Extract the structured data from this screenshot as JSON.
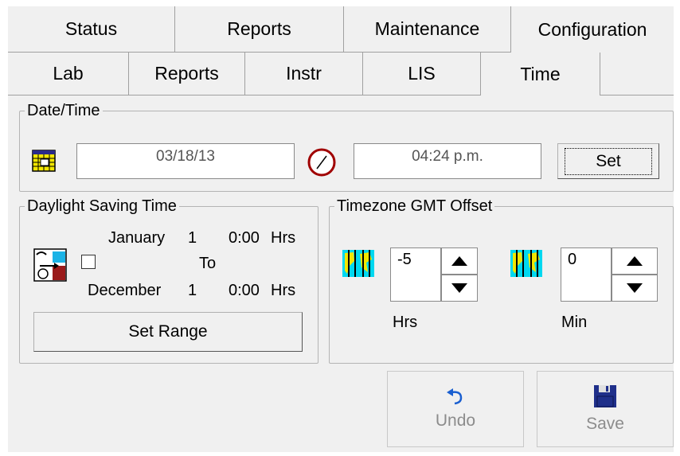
{
  "tabs_top": [
    {
      "label": "Status"
    },
    {
      "label": "Reports"
    },
    {
      "label": "Maintenance"
    },
    {
      "label": "Configuration",
      "active": true
    }
  ],
  "tabs_sub": [
    {
      "label": "Lab"
    },
    {
      "label": "Reports"
    },
    {
      "label": "Instr"
    },
    {
      "label": "LIS"
    },
    {
      "label": "Time",
      "active": true
    }
  ],
  "datetime": {
    "legend": "Date/Time",
    "date_value": "03/18/13",
    "time_value": "04:24 p.m.",
    "set_label": "Set",
    "icons": [
      "calendar-icon",
      "clock-icon"
    ]
  },
  "dst": {
    "legend": "Daylight Saving Time",
    "start_month": "January",
    "start_day": "1",
    "start_time": "0:00",
    "start_unit": "Hrs",
    "to_label": "To",
    "end_month": "December",
    "end_day": "1",
    "end_time": "0:00",
    "end_unit": "Hrs",
    "enabled": false,
    "set_range_label": "Set Range"
  },
  "timezone": {
    "legend": "Timezone GMT Offset",
    "hrs_value": "-5",
    "hrs_label": "Hrs",
    "min_value": "0",
    "min_label": "Min"
  },
  "actions": {
    "undo_label": "Undo",
    "save_label": "Save",
    "disabled_color": "#8c8c8c",
    "undo_icon_color": "#1a5fd0",
    "save_icon_color": "#1f2f8a"
  }
}
